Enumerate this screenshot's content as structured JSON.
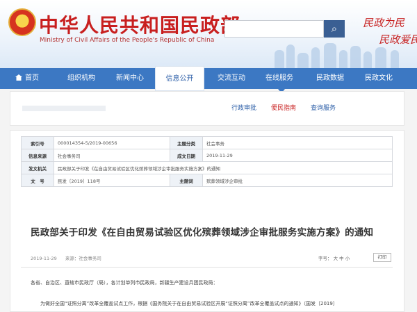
{
  "header": {
    "site_title": "中华人民共和国民政部",
    "site_subtitle": "Ministry of Civil Affairs of the People's Republic of China",
    "search_placeholder": "",
    "search_icon": "search-icon",
    "slogan_line1": "民政为民",
    "slogan_line2": "民政爱民"
  },
  "nav": {
    "items": [
      {
        "label": "首页",
        "icon": "home-icon"
      },
      {
        "label": "组织机构"
      },
      {
        "label": "新闻中心"
      },
      {
        "label": "信息公开",
        "active": true
      },
      {
        "label": "交流互动"
      },
      {
        "label": "在线服务"
      },
      {
        "label": "民政数据"
      },
      {
        "label": "民政文化"
      }
    ]
  },
  "subnav": {
    "items": [
      {
        "label": "行政审批"
      },
      {
        "label": "便民指南",
        "active": true
      },
      {
        "label": "查询服务"
      }
    ]
  },
  "meta_table": {
    "rows": [
      {
        "l1": "索引号",
        "v1": "000014354-5/2019-00656",
        "l2": "主题分类",
        "v2": "社会事务"
      },
      {
        "l1": "信息来源",
        "v1": "社会事务司",
        "l2": "成文日期",
        "v2": "2019-11-29"
      },
      {
        "l1": "发文机关",
        "v1": "民政部关于印发《在自由贸易试验区优化殡葬领域涉企审批服务实施方案》的通知",
        "l2": "",
        "v2": ""
      },
      {
        "l1": "文　号",
        "v1": "民发〔2019〕118号",
        "l2": "主题词",
        "v2": "殡葬领域涉企审批"
      }
    ]
  },
  "document": {
    "title": "民政部关于印发《在自由贸易试验区优化殡葬领域涉企审批服务实施方案》的通知",
    "date": "2019-11-29",
    "source_label": "来源：",
    "source": "社会事务司",
    "font_size_label": "字号：",
    "font_size_options": [
      "大",
      "中",
      "小"
    ],
    "print_label": "打印",
    "paragraph1": "各省、自治区、直辖市民政厅（局），各计划单列市民政局，新疆生产建设兵团民政局：",
    "paragraph2": "为做好全国“证照分离”改革全覆盖试点工作，根据《国务院关于在自由贸易试验区开展“证照分离”改革全覆盖试点的通知》（国发〔2019〕"
  },
  "colors": {
    "brand_red": "#c81f1f",
    "nav_blue": "#3c78c3",
    "link_blue": "#2d5fa8"
  }
}
